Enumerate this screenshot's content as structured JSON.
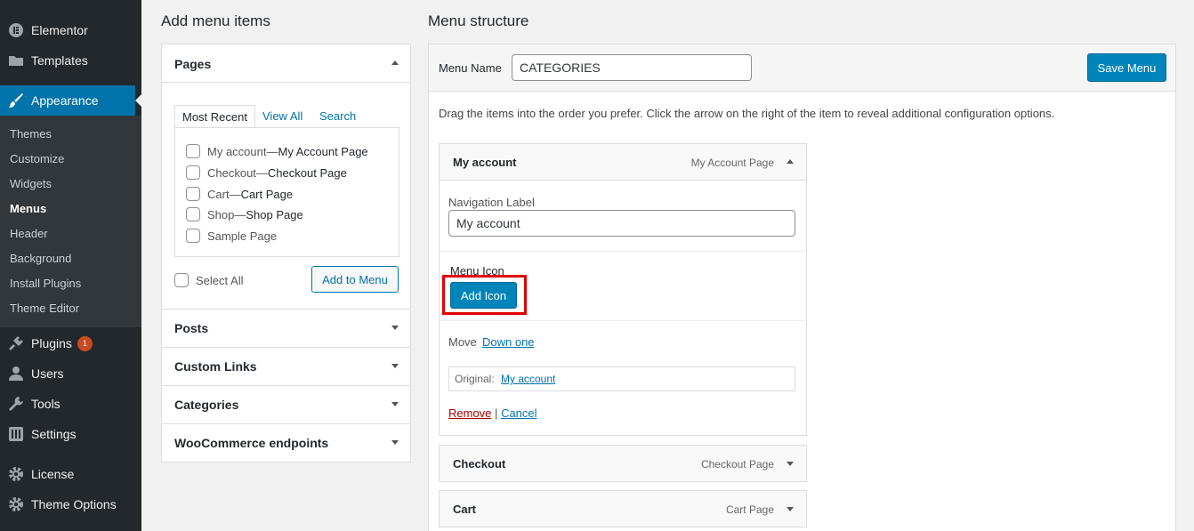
{
  "sidebar": {
    "top_items": [
      {
        "label": "Elementor",
        "icon": "elementor-icon"
      },
      {
        "label": "Templates",
        "icon": "folder-icon"
      }
    ],
    "active": {
      "label": "Appearance",
      "icon": "paintbrush-icon"
    },
    "submenu": [
      "Themes",
      "Customize",
      "Widgets",
      "Menus",
      "Header",
      "Background",
      "Install Plugins",
      "Theme Editor"
    ],
    "bottom_items": [
      {
        "label": "Plugins",
        "icon": "plugin-icon",
        "badge": "1"
      },
      {
        "label": "Users",
        "icon": "users-icon"
      },
      {
        "label": "Tools",
        "icon": "wrench-icon"
      },
      {
        "label": "Settings",
        "icon": "settings-icon"
      },
      {
        "label": "License",
        "icon": "gear-icon"
      },
      {
        "label": "Theme Options",
        "icon": "gear-icon"
      }
    ]
  },
  "left": {
    "title": "Add menu items",
    "pages": {
      "header": "Pages",
      "tabs": [
        "Most Recent",
        "View All",
        "Search"
      ],
      "items": [
        {
          "title": "My account",
          "sep": " — ",
          "tag": "My Account Page"
        },
        {
          "title": "Checkout",
          "sep": " — ",
          "tag": "Checkout Page"
        },
        {
          "title": "Cart",
          "sep": " — ",
          "tag": "Cart Page"
        },
        {
          "title": "Shop",
          "sep": " — ",
          "tag": "Shop Page"
        },
        {
          "title": "Sample Page",
          "sep": "",
          "tag": ""
        }
      ],
      "select_all": "Select All",
      "add_button": "Add to Menu"
    },
    "sections": [
      "Posts",
      "Custom Links",
      "Categories",
      "WooCommerce endpoints"
    ]
  },
  "right": {
    "title": "Menu structure",
    "menu_name_label": "Menu Name",
    "menu_name_value": "CATEGORIES",
    "save_button": "Save Menu",
    "instructions": "Drag the items into the order you prefer. Click the arrow on the right of the item to reveal additional configuration options.",
    "expanded_item": {
      "title": "My account",
      "type": "My Account Page",
      "nav_label_caption": "Navigation Label",
      "nav_label_value": "My account",
      "menu_icon_caption": "Menu Icon",
      "add_icon_button": "Add Icon",
      "move_label": "Move",
      "move_link": "Down one",
      "original_label": "Original:",
      "original_link": "My account",
      "remove_link": "Remove",
      "divider": "|",
      "cancel_link": "Cancel"
    },
    "collapsed_items": [
      {
        "title": "Checkout",
        "type": "Checkout Page"
      },
      {
        "title": "Cart",
        "type": "Cart Page"
      }
    ]
  },
  "colors": {
    "accent": "#0073aa",
    "highlight_box": "#e00000"
  }
}
